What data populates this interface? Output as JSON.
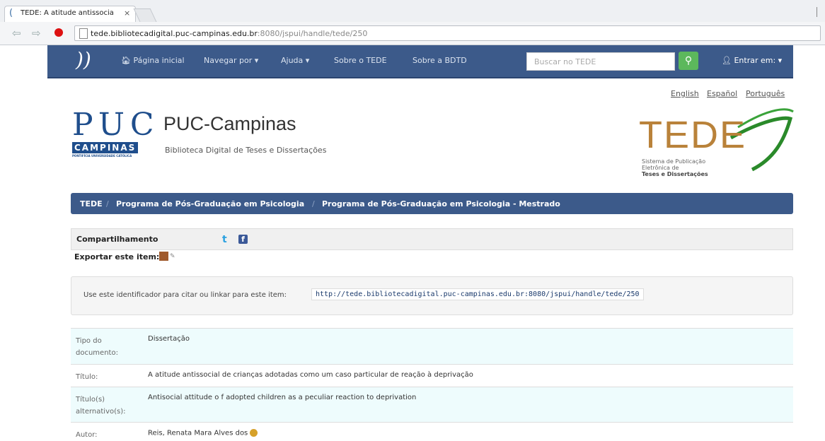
{
  "browser": {
    "tab_title": "TEDE: A atitude antissocia",
    "tab_close": "×",
    "url_host": "tede.bibliotecadigital.puc-campinas.edu.br",
    "url_path": ":8080/jspui/handle/tede/250"
  },
  "navbar": {
    "home": "Página inicial",
    "browse": "Navegar por ▾",
    "help": "Ajuda ▾",
    "about_tede": "Sobre o TEDE",
    "about_bdtd": "Sobre a BDTD",
    "search_placeholder": "Buscar no TEDE",
    "login": "Entrar em: ▾"
  },
  "languages": [
    "English",
    "Español",
    "Português"
  ],
  "header": {
    "puc_big": "PUC",
    "puc_campinas": "CAMPINAS",
    "puc_pontificia": "PONTIFÍCIA UNIVERSIDADE CATÓLICA",
    "title": "PUC-Campinas",
    "subtitle": "Biblioteca Digital de Teses e Dissertações",
    "tede_word": "TEDE",
    "tede_sub1": "Sistema de Publicação",
    "tede_sub2": "Eletrônica de",
    "tede_sub3": "Teses e Dissertações"
  },
  "breadcrumb": {
    "items": [
      "TEDE",
      "Programa de Pós-Graduação em Psicologia",
      "Programa de Pós-Graduação em Psicologia - Mestrado"
    ],
    "sep": "/"
  },
  "share": {
    "label": "Compartilhamento",
    "twitter": "t",
    "facebook": "f"
  },
  "export": {
    "label": "Exportar este item:"
  },
  "cite": {
    "text": "Use este identificador para citar ou linkar para este item:",
    "handle": "http://tede.bibliotecadigital.puc-campinas.edu.br:8080/jspui/handle/tede/250"
  },
  "metadata": [
    {
      "key": "Tipo do documento:",
      "value": "Dissertação"
    },
    {
      "key": "Título:",
      "value": "A atitude antissocial de crianças adotadas como um caso particular de reação à deprivação"
    },
    {
      "key": "Título(s) alternativo(s):",
      "value": "Antisocial attitude o f adopted children as a peculiar reaction to deprivation"
    },
    {
      "key": "Autor:",
      "value": "Reis, Renata Mara Alves dos"
    }
  ]
}
